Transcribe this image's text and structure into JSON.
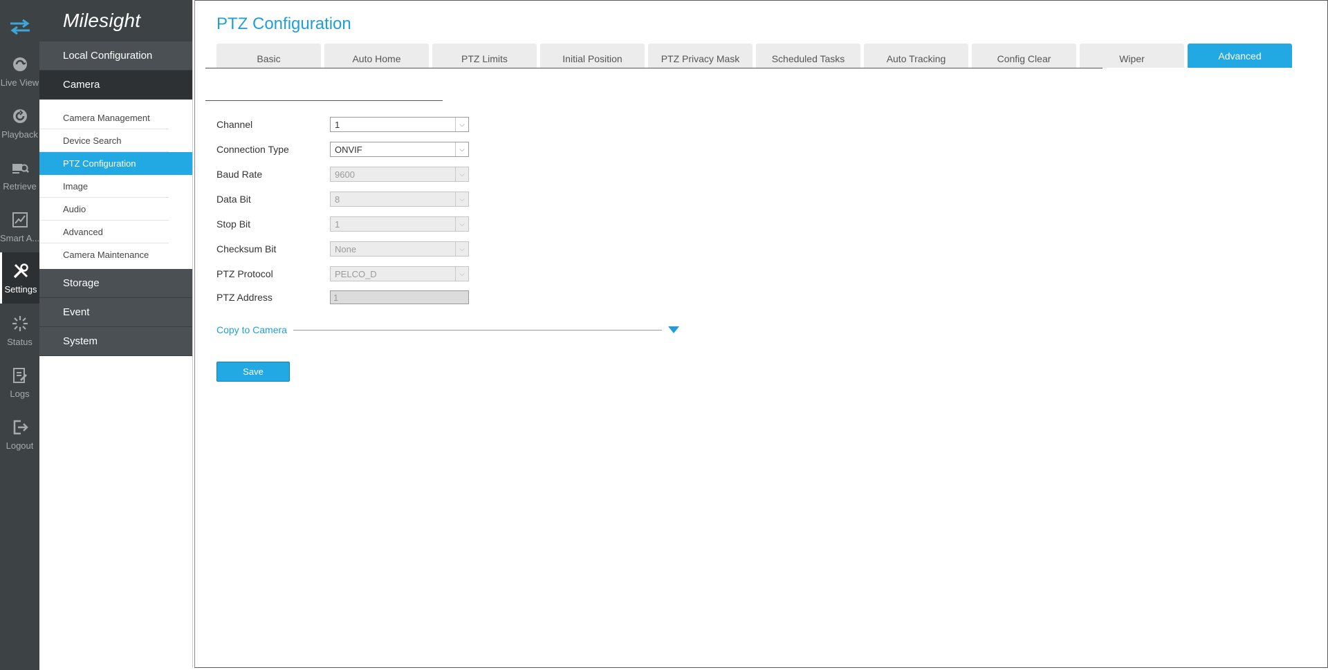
{
  "brand": {
    "logo_text": "Milesight"
  },
  "iconbar": {
    "items": [
      {
        "label": "Live View",
        "icon": "live-view-icon"
      },
      {
        "label": "Playback",
        "icon": "playback-icon"
      },
      {
        "label": "Retrieve",
        "icon": "retrieve-icon"
      },
      {
        "label": "Smart A...",
        "icon": "smart-analysis-icon"
      },
      {
        "label": "Settings",
        "icon": "settings-icon",
        "active": true
      },
      {
        "label": "Status",
        "icon": "status-icon"
      },
      {
        "label": "Logs",
        "icon": "logs-icon"
      },
      {
        "label": "Logout",
        "icon": "logout-icon"
      }
    ]
  },
  "menu": {
    "local_configuration": "Local Configuration",
    "camera": "Camera",
    "camera_items": [
      "Camera Management",
      "Device Search",
      "PTZ Configuration",
      "Image",
      "Audio",
      "Advanced",
      "Camera Maintenance"
    ],
    "active_camera_item": "PTZ Configuration",
    "storage": "Storage",
    "event": "Event",
    "system": "System"
  },
  "page": {
    "title": "PTZ Configuration",
    "tabs": [
      "Basic",
      "Auto Home",
      "PTZ Limits",
      "Initial Position",
      "PTZ Privacy Mask",
      "Scheduled Tasks",
      "Auto Tracking",
      "Config Clear",
      "Wiper",
      "Advanced"
    ],
    "active_tab": "Advanced"
  },
  "form": {
    "channel": {
      "label": "Channel",
      "value": "1"
    },
    "connection_type": {
      "label": "Connection Type",
      "value": "ONVIF"
    },
    "baud_rate": {
      "label": "Baud Rate",
      "value": "9600"
    },
    "data_bit": {
      "label": "Data Bit",
      "value": "8"
    },
    "stop_bit": {
      "label": "Stop Bit",
      "value": "1"
    },
    "checksum_bit": {
      "label": "Checksum Bit",
      "value": "None"
    },
    "ptz_protocol": {
      "label": "PTZ Protocol",
      "value": "PELCO_D"
    },
    "ptz_address": {
      "label": "PTZ Address",
      "value": "1"
    }
  },
  "copy_to_camera": {
    "label": "Copy to Camera"
  },
  "actions": {
    "save": "Save"
  },
  "colors": {
    "accent": "#22a9e3",
    "title": "#1e9fd8",
    "sidebar_dark": "#3d4245",
    "menu_header": "#4b5054"
  }
}
